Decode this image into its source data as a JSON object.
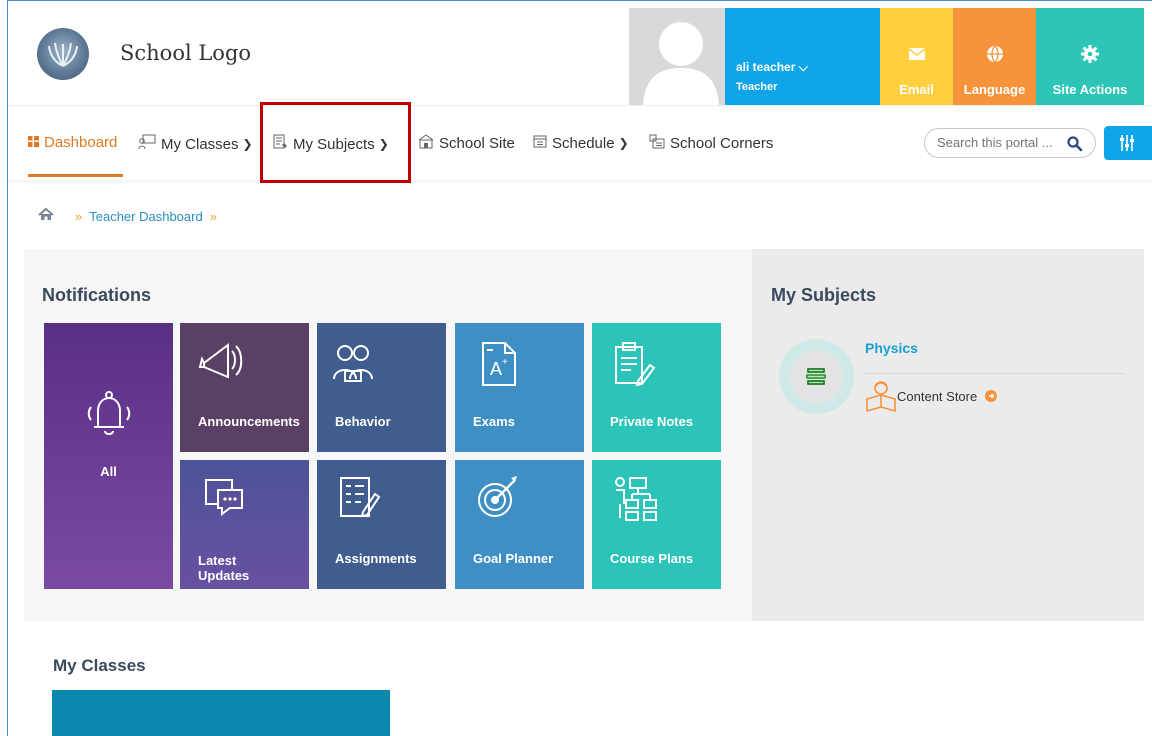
{
  "header": {
    "logo_text": "School Logo",
    "user_name": "ali teacher",
    "user_role": "Teacher",
    "tiles": [
      {
        "label": "Email",
        "icon": "envelope-icon",
        "color": "#ffcf3f"
      },
      {
        "label": "Language",
        "icon": "globe-icon",
        "color": "#f7943b"
      },
      {
        "label": "Site Actions",
        "icon": "gear-icon",
        "color": "#2cc5b8"
      }
    ],
    "user_tile_color": "#0fa5e8"
  },
  "nav": {
    "items": [
      {
        "label": "Dashboard",
        "icon": "dashboard-icon",
        "active": true
      },
      {
        "label": "My Classes",
        "icon": "classes-icon",
        "dropdown": true
      },
      {
        "label": "My Subjects",
        "icon": "subjects-icon",
        "dropdown": true,
        "highlighted": true
      },
      {
        "label": "School Site",
        "icon": "school-icon"
      },
      {
        "label": "Schedule",
        "icon": "calendar-icon",
        "dropdown": true
      },
      {
        "label": "School Corners",
        "icon": "corners-icon"
      }
    ],
    "search_placeholder": "Search this portal ...",
    "accent": "#e07b24",
    "highlight_color": "#c00000"
  },
  "breadcrumb": {
    "items": [
      "Teacher Dashboard"
    ]
  },
  "notifications": {
    "title": "Notifications",
    "tiles": [
      {
        "label": "All",
        "icon": "bell-icon",
        "color": "#6a3d94"
      },
      {
        "label": "Announcements",
        "icon": "megaphone-icon",
        "color": "#5b4066"
      },
      {
        "label": "Behavior",
        "icon": "students-icon",
        "color": "#3f5e8f"
      },
      {
        "label": "Exams",
        "icon": "exam-icon",
        "color": "#3f8fc4"
      },
      {
        "label": "Private Notes",
        "icon": "notes-icon",
        "color": "#2cc3b8"
      },
      {
        "label": "Latest Updates",
        "icon": "chat-icon",
        "color": "#5b4f9c"
      },
      {
        "label": "Assignments",
        "icon": "assignment-icon",
        "color": "#3f5e8f"
      },
      {
        "label": "Goal Planner",
        "icon": "target-icon",
        "color": "#3f8fc4"
      },
      {
        "label": "Course Plans",
        "icon": "plan-icon",
        "color": "#2cc3b8"
      }
    ]
  },
  "subjects": {
    "title": "My Subjects",
    "items": [
      {
        "name": "Physics",
        "link_label": "Content Store"
      }
    ]
  },
  "classes": {
    "title": "My Classes"
  }
}
